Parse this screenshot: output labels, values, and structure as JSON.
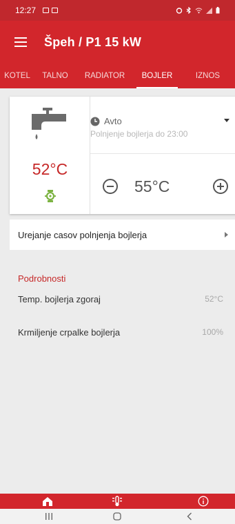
{
  "status_bar": {
    "time": "12:27",
    "left_icons": [
      "gallery-icon",
      "message-icon"
    ],
    "right_icons": [
      "alarm-icon",
      "bluetooth-icon",
      "wifi-icon",
      "signal-icon",
      "battery-icon"
    ]
  },
  "app_bar": {
    "title": "Špeh / P1 15 kW",
    "menu_icon": "menu-icon"
  },
  "tabs": [
    {
      "label": "KOTEL",
      "active": false
    },
    {
      "label": "TALNO",
      "active": false
    },
    {
      "label": "RADIATOR",
      "active": false
    },
    {
      "label": "BOJLER",
      "active": true
    },
    {
      "label": "IZNOS",
      "active": false
    }
  ],
  "boiler_card": {
    "current_temp": "52°C",
    "mode": "Avto",
    "mode_sub": "Polnjenje bojlerja do 23:00",
    "setpoint": "55°C"
  },
  "schedule_row": {
    "label": "Urejanje casov polnjenja bojlerja"
  },
  "details": {
    "title": "Podrobnosti",
    "items": [
      {
        "label": "Temp. bojlerja zgoraj",
        "value": "52°C"
      },
      {
        "label": "Krmiljenje crpalke bojlerja",
        "value": "100%"
      }
    ]
  },
  "bottom_bar": {
    "icons": [
      "house-icon",
      "thermometer-icon",
      "info-icon"
    ]
  },
  "colors": {
    "primary": "#d2262c",
    "status": "#c0282d",
    "temp_red": "#c62828",
    "pump_green": "#7cb342"
  }
}
